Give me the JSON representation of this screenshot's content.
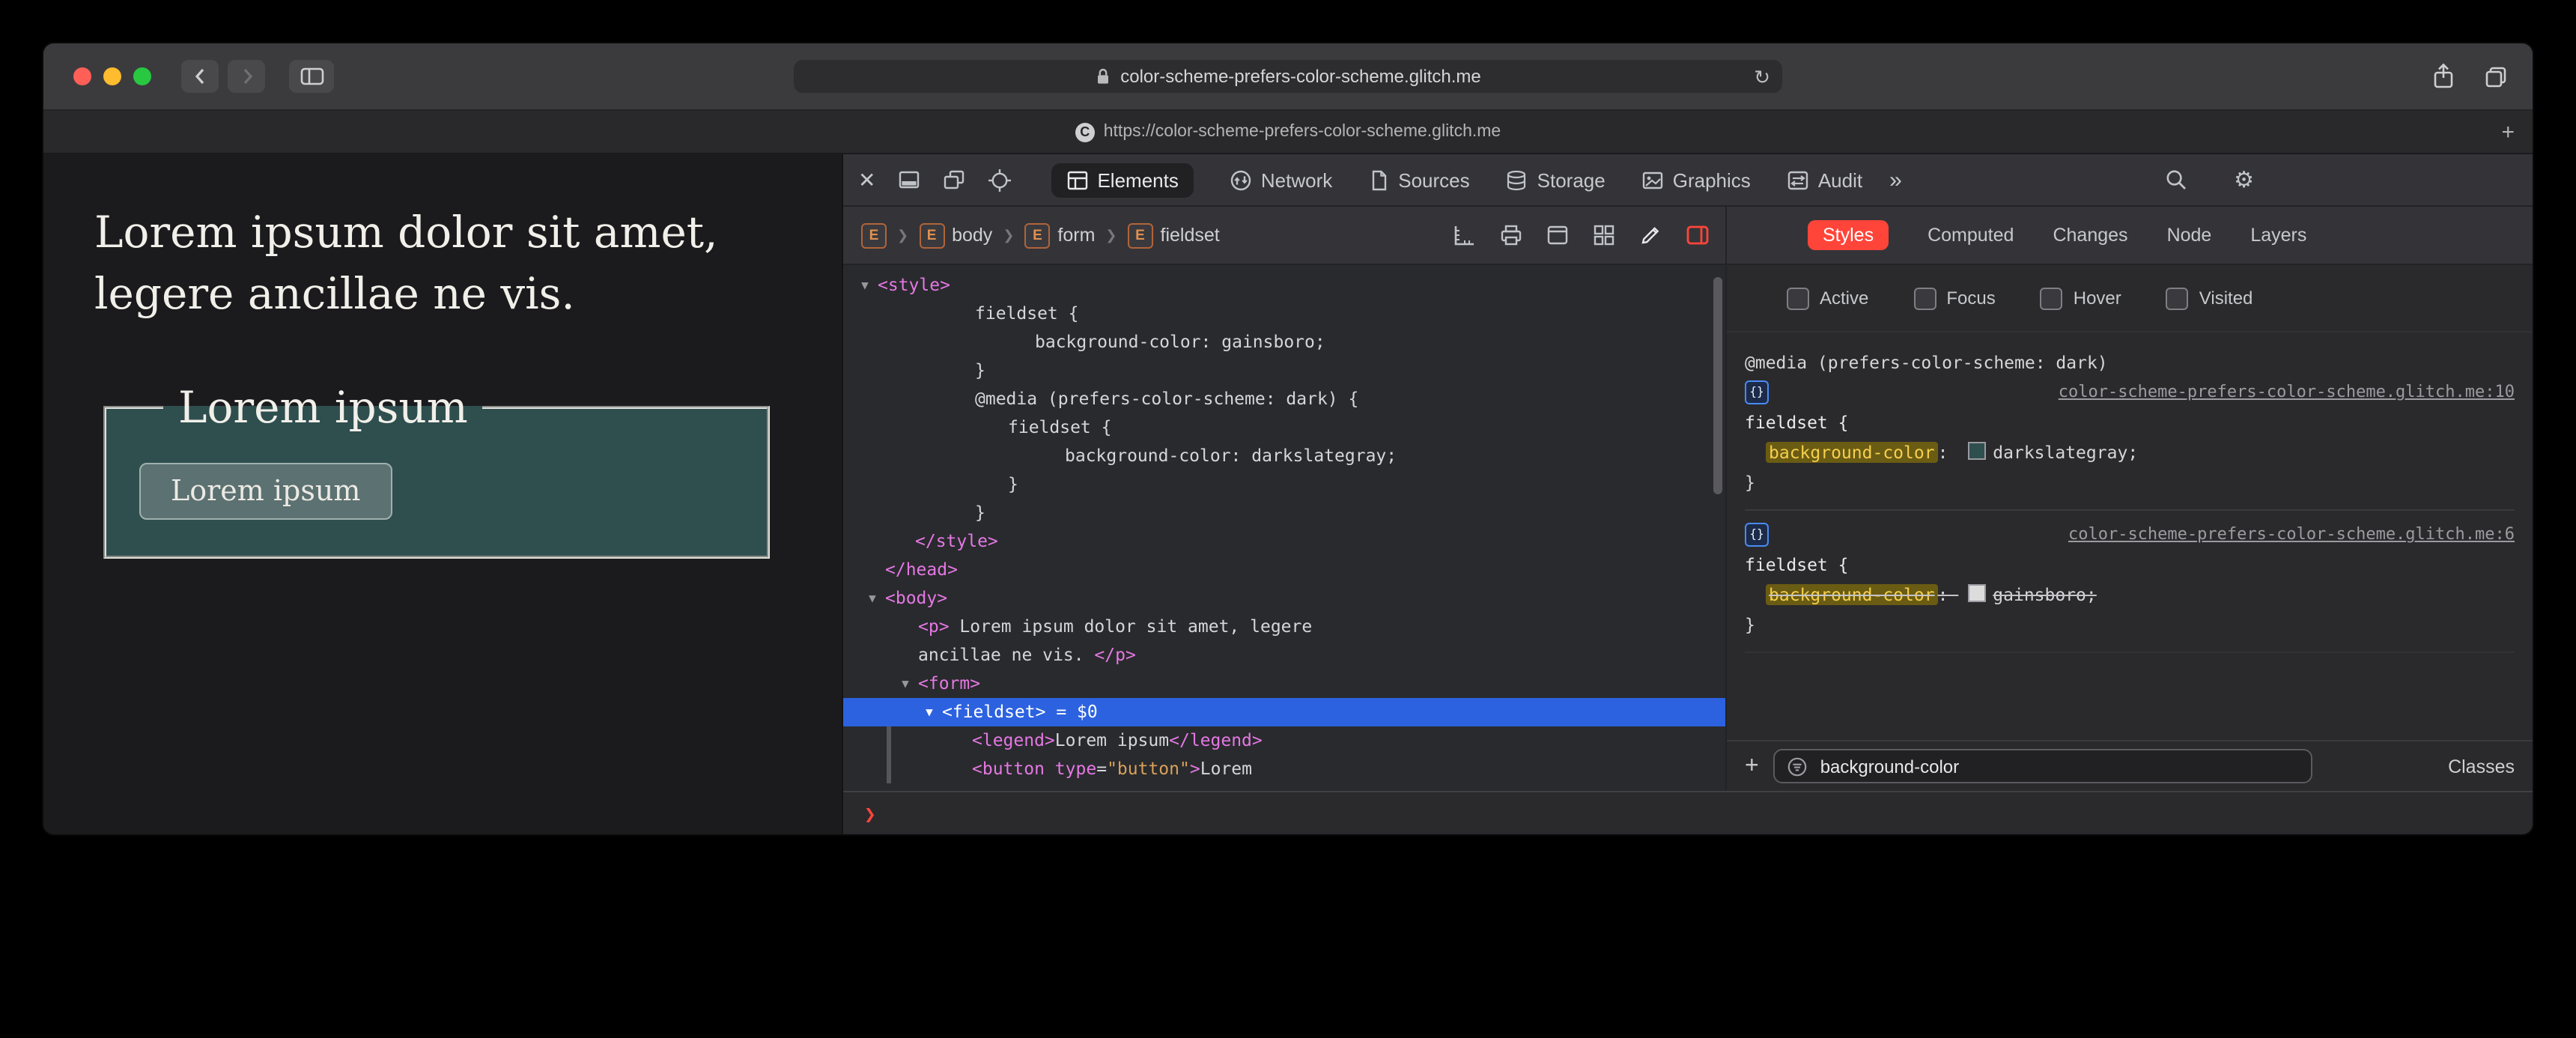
{
  "browser": {
    "address": "color-scheme-prefers-color-scheme.glitch.me",
    "refresh_glyph": "↻",
    "tab_title": "https://color-scheme-prefers-color-scheme.glitch.me",
    "tab_favicon_letter": "C",
    "new_tab_glyph": "+"
  },
  "page": {
    "paragraph": "Lorem ipsum dolor sit amet, legere ancillae ne vis.",
    "fieldset_legend": "Lorem ipsum",
    "button_label": "Lorem ipsum",
    "fieldset_bg": "#2f4f4f"
  },
  "devtools": {
    "close_glyph": "✕",
    "more_glyph": "»",
    "gear_glyph": "⚙",
    "tabs": [
      {
        "label": "Elements",
        "selected": true
      },
      {
        "label": "Network"
      },
      {
        "label": "Sources"
      },
      {
        "label": "Storage"
      },
      {
        "label": "Graphics"
      },
      {
        "label": "Audit"
      }
    ],
    "breadcrumbs": [
      {
        "badge": "E",
        "label": ""
      },
      {
        "badge": "E",
        "label": "body"
      },
      {
        "badge": "E",
        "label": "form"
      },
      {
        "badge": "E",
        "label": "fieldset"
      }
    ],
    "dom_tree": {
      "arrow_glyph": "▼",
      "lines": [
        {
          "pad": 23,
          "arrow": true,
          "segs": [
            {
              "c": "tag",
              "t": "<style>"
            }
          ]
        },
        {
          "pad": 88,
          "segs": [
            {
              "c": "plain",
              "t": "fieldset {"
            }
          ]
        },
        {
          "pad": 128,
          "segs": [
            {
              "c": "plain",
              "t": "background-color: gainsboro;"
            }
          ]
        },
        {
          "pad": 88,
          "segs": [
            {
              "c": "plain",
              "t": "}"
            }
          ]
        },
        {
          "pad": 88,
          "segs": [
            {
              "c": "plain",
              "t": "@media (prefers-color-scheme: dark) {"
            }
          ]
        },
        {
          "pad": 110,
          "segs": [
            {
              "c": "plain",
              "t": "fieldset {"
            }
          ]
        },
        {
          "pad": 148,
          "segs": [
            {
              "c": "plain",
              "t": "background-color: darkslategray;"
            }
          ]
        },
        {
          "pad": 110,
          "segs": [
            {
              "c": "plain",
              "t": "}"
            }
          ]
        },
        {
          "pad": 88,
          "segs": [
            {
              "c": "plain",
              "t": "}"
            }
          ]
        },
        {
          "pad": 48,
          "segs": [
            {
              "c": "tag",
              "t": "</style>"
            }
          ]
        },
        {
          "pad": 28,
          "segs": [
            {
              "c": "tag",
              "t": "</head>"
            }
          ]
        },
        {
          "pad": 28,
          "arrow": true,
          "segs": [
            {
              "c": "tag",
              "t": "<body>"
            }
          ]
        },
        {
          "pad": 50,
          "segs": [
            {
              "c": "tag",
              "t": "<p>"
            },
            {
              "c": "plain",
              "t": " Lorem ipsum dolor sit amet, legere"
            }
          ]
        },
        {
          "pad": 50,
          "segs": [
            {
              "c": "plain",
              "t": "ancillae ne vis. "
            },
            {
              "c": "tag",
              "t": "</p>"
            }
          ]
        },
        {
          "pad": 50,
          "arrow": true,
          "segs": [
            {
              "c": "tag",
              "t": "<form>"
            }
          ]
        },
        {
          "pad": 66,
          "arrow": true,
          "selected": true,
          "segs": [
            {
              "c": "tag",
              "t": "<fieldset>"
            },
            {
              "c": "flag",
              "t": " = $0"
            }
          ]
        },
        {
          "pad": 86,
          "segs": [
            {
              "c": "tag",
              "t": "<legend>"
            },
            {
              "c": "plain",
              "t": "Lorem ipsum"
            },
            {
              "c": "tag",
              "t": "</legend>"
            }
          ]
        },
        {
          "pad": 86,
          "segs": [
            {
              "c": "tag",
              "t": "<button"
            },
            {
              "c": "attr",
              "t": " type"
            },
            {
              "c": "plain",
              "t": "="
            },
            {
              "c": "val",
              "t": "\"button\""
            },
            {
              "c": "tag",
              "t": ">"
            },
            {
              "c": "plain",
              "t": "Lorem"
            }
          ]
        }
      ]
    },
    "styles_panel": {
      "tabs": [
        "Styles",
        "Computed",
        "Changes",
        "Node",
        "Layers"
      ],
      "selected_tab": "Styles",
      "pseudo_toggles": [
        "Active",
        "Focus",
        "Hover",
        "Visited"
      ],
      "badge_glyph": "{}",
      "rules": [
        {
          "media": "@media (prefers-color-scheme: dark)",
          "source_link": "color-scheme-prefers-color-scheme.glitch.me:10",
          "selector_open": "fieldset {",
          "property": "background-color",
          "colon": ": ",
          "value": "darkslategray",
          "semicolon": ";",
          "swatch_color": "#2f4f4f",
          "close_brace": "}"
        },
        {
          "source_link": "color-scheme-prefers-color-scheme.glitch.me:6",
          "selector_open": "fieldset {",
          "property": "background-color",
          "colon": ": ",
          "value": "gainsboro",
          "semicolon": ";",
          "swatch_color": "#dcdcdc",
          "overridden": true,
          "close_brace": "}"
        }
      ],
      "filter_value": "background-color",
      "add_glyph": "+",
      "classes_label": "Classes"
    },
    "console_prompt_glyph": "❯"
  },
  "colors": {
    "selection_blue": "#2c62e0",
    "styles_tab_red": "#ff453a",
    "prompt_red": "#ff453a",
    "highlight_yellow_bg": "#6b5c13",
    "highlight_yellow_text": "#f5cf4e"
  }
}
